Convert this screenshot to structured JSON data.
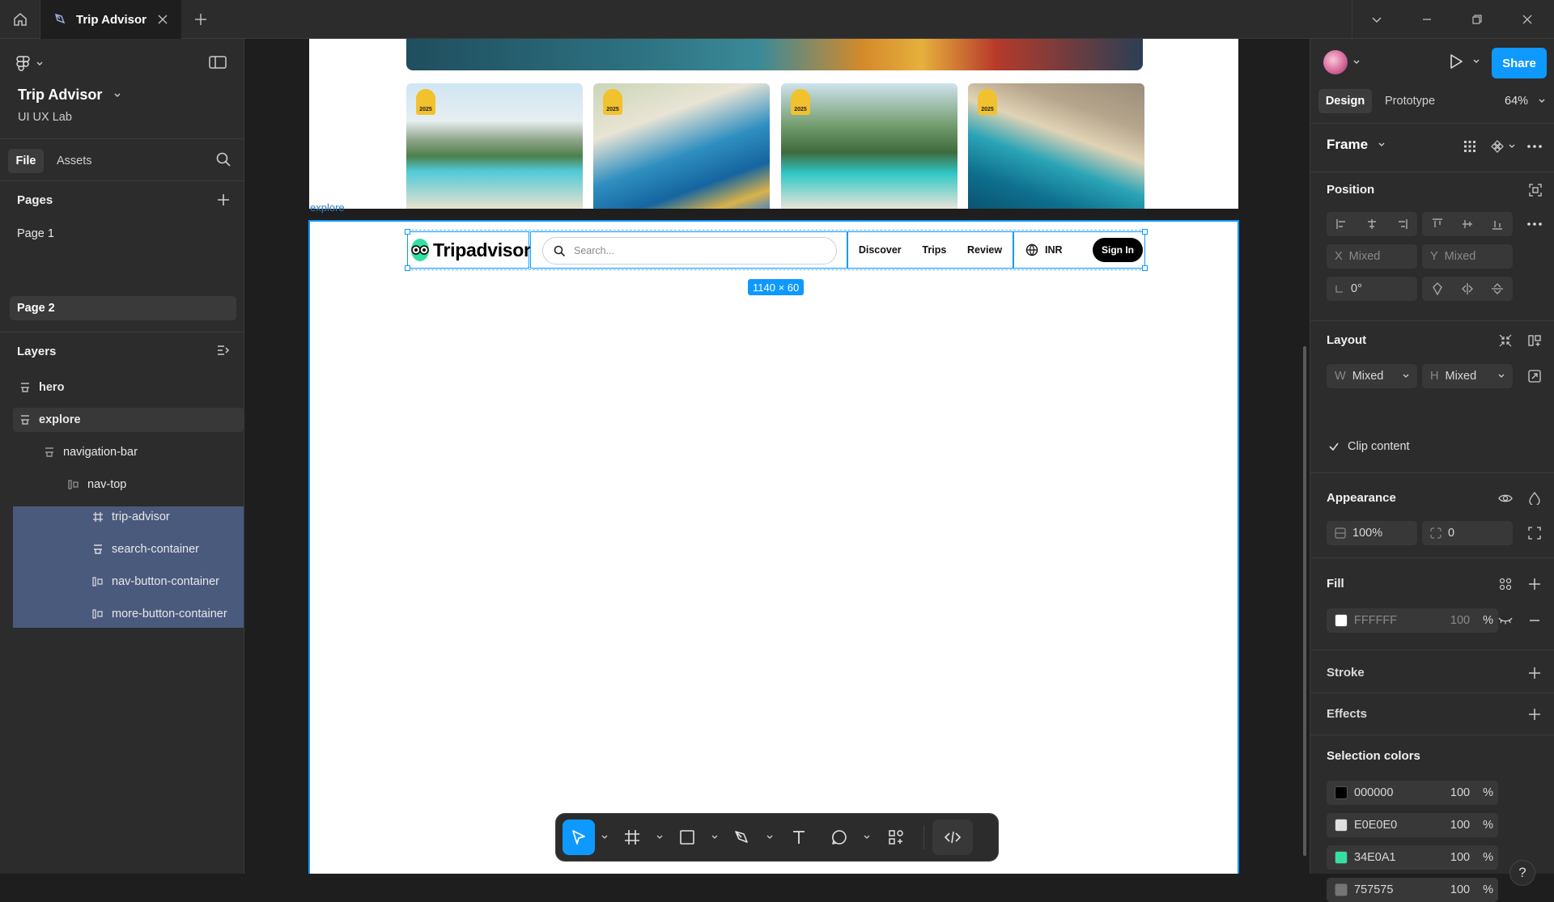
{
  "titlebar": {
    "tab_title": "Trip Advisor"
  },
  "left_panel": {
    "project_name": "Trip Advisor",
    "team_name": "UI UX Lab",
    "tabs": [
      "File",
      "Assets"
    ],
    "pages_title": "Pages",
    "pages": [
      "Page 1",
      "Page 2"
    ],
    "layers_title": "Layers",
    "layers": [
      {
        "name": "hero",
        "icon": "frame-icon",
        "depth": 0
      },
      {
        "name": "explore",
        "icon": "frame-icon",
        "depth": 0
      },
      {
        "name": "navigation-bar",
        "icon": "frame-icon",
        "depth": 1
      },
      {
        "name": "nav-top",
        "icon": "auto-layout-icon",
        "depth": 2
      },
      {
        "name": "trip-advisor",
        "icon": "hash-frame-icon",
        "depth": 3
      },
      {
        "name": "search-container",
        "icon": "frame-icon",
        "depth": 3
      },
      {
        "name": "nav-button-container",
        "icon": "auto-layout-icon",
        "depth": 3
      },
      {
        "name": "more-button-container",
        "icon": "auto-layout-icon",
        "depth": 3
      }
    ]
  },
  "canvas": {
    "frame_label": "explore",
    "size_label": "1140 × 60",
    "nav": {
      "logo_text": "Tripadvisor",
      "search_placeholder": "Search...",
      "links": [
        "Discover",
        "Trips",
        "Review"
      ],
      "currency": "INR",
      "signin": "Sign In"
    },
    "award_badge": "2025"
  },
  "right_panel": {
    "share": "Share",
    "tabs": [
      "Design",
      "Prototype"
    ],
    "zoom": "64%",
    "frame_title": "Frame",
    "position": {
      "title": "Position",
      "x_label": "X",
      "x_value": "Mixed",
      "y_label": "Y",
      "y_value": "Mixed",
      "rotation": "0°"
    },
    "layout": {
      "title": "Layout",
      "w_label": "W",
      "w_value": "Mixed",
      "h_label": "H",
      "h_value": "Mixed",
      "clip_label": "Clip content"
    },
    "appearance": {
      "title": "Appearance",
      "opacity": "100%",
      "radius": "0"
    },
    "fill": {
      "title": "Fill",
      "hex": "FFFFFF",
      "opacity": "100",
      "pct": "%"
    },
    "stroke_title": "Stroke",
    "effects_title": "Effects",
    "selection_colors": {
      "title": "Selection colors",
      "items": [
        {
          "hex": "000000",
          "color": "#000000",
          "opacity": "100",
          "pct": "%"
        },
        {
          "hex": "E0E0E0",
          "color": "#E0E0E0",
          "opacity": "100",
          "pct": "%"
        },
        {
          "hex": "34E0A1",
          "color": "#34E0A1",
          "opacity": "100",
          "pct": "%"
        },
        {
          "hex": "757575",
          "color": "#757575",
          "opacity": "100",
          "pct": "%"
        }
      ]
    },
    "help": "?"
  },
  "colors": {
    "accent": "#0d99ff",
    "brand_green": "#34E0A1"
  }
}
